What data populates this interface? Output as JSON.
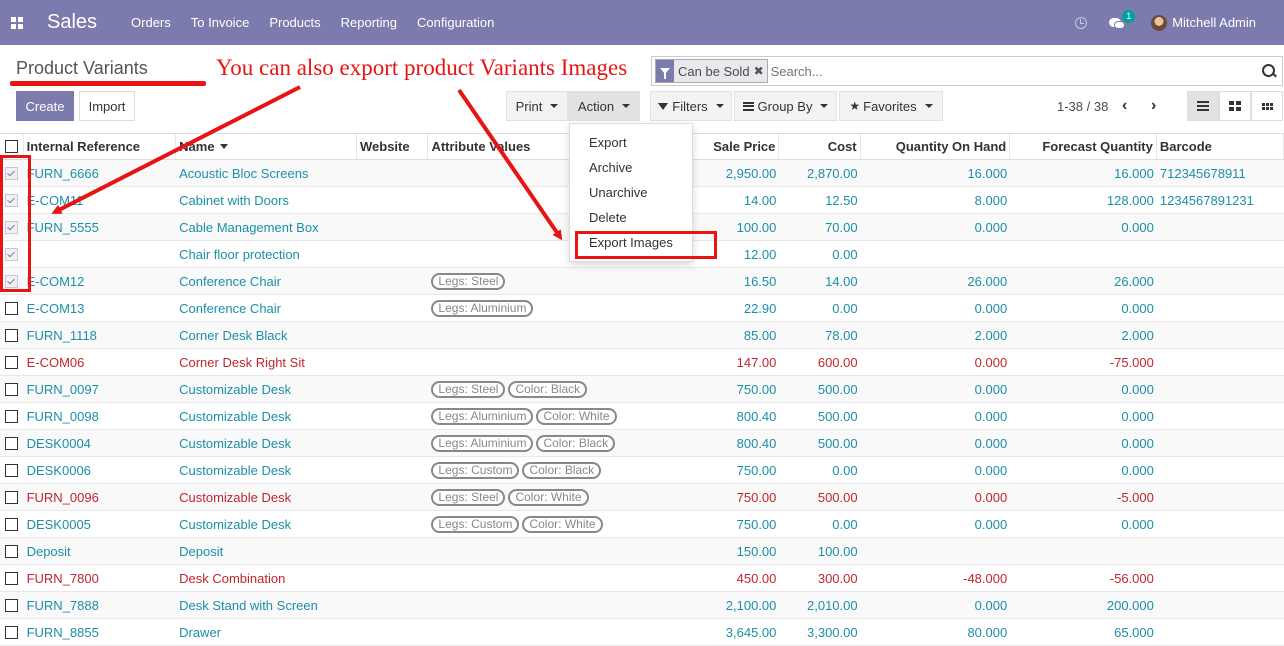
{
  "navbar": {
    "brand": "Sales",
    "menu": [
      "Orders",
      "To Invoice",
      "Products",
      "Reporting",
      "Configuration"
    ],
    "chat_badge": "1",
    "user": "Mitchell Admin"
  },
  "breadcrumb": "Product Variants",
  "annotation": "You can also export product Variants Images",
  "search": {
    "facet": "Can be Sold",
    "placeholder": "Search..."
  },
  "buttons": {
    "create": "Create",
    "import": "Import",
    "print": "Print",
    "action": "Action",
    "filters": "Filters",
    "group_by": "Group By",
    "favorites": "Favorites"
  },
  "pager": "1-38 / 38",
  "action_menu": [
    "Export",
    "Archive",
    "Unarchive",
    "Delete",
    "Export Images"
  ],
  "columns": [
    "Internal Reference",
    "Name",
    "Website",
    "Attribute Values",
    "Sale Price",
    "Cost",
    "Quantity On Hand",
    "Forecast Quantity",
    "Barcode"
  ],
  "rows": [
    {
      "checked": true,
      "ref": "FURN_6666",
      "name": "Acoustic Bloc Screens",
      "attrs": [],
      "sale": "2,950.00",
      "cost": "2,870.00",
      "qoh": "16.000",
      "fq": "16.000",
      "barcode": "712345678911",
      "red": false
    },
    {
      "checked": true,
      "ref": "E-COM11",
      "name": "Cabinet with Doors",
      "attrs": [],
      "sale": "14.00",
      "cost": "12.50",
      "qoh": "8.000",
      "fq": "128.000",
      "barcode": "1234567891231",
      "red": false
    },
    {
      "checked": true,
      "ref": "FURN_5555",
      "name": "Cable Management Box",
      "attrs": [],
      "sale": "100.00",
      "cost": "70.00",
      "qoh": "0.000",
      "fq": "0.000",
      "barcode": "",
      "red": false
    },
    {
      "checked": true,
      "ref": "",
      "name": "Chair floor protection",
      "attrs": [],
      "sale": "12.00",
      "cost": "0.00",
      "qoh": "",
      "fq": "",
      "barcode": "",
      "red": false
    },
    {
      "checked": true,
      "ref": "E-COM12",
      "name": "Conference Chair",
      "attrs": [
        "Legs: Steel"
      ],
      "sale": "16.50",
      "cost": "14.00",
      "qoh": "26.000",
      "fq": "26.000",
      "barcode": "",
      "red": false
    },
    {
      "checked": false,
      "ref": "E-COM13",
      "name": "Conference Chair",
      "attrs": [
        "Legs: Aluminium"
      ],
      "sale": "22.90",
      "cost": "0.00",
      "qoh": "0.000",
      "fq": "0.000",
      "barcode": "",
      "red": false
    },
    {
      "checked": false,
      "ref": "FURN_1118",
      "name": "Corner Desk Black",
      "attrs": [],
      "sale": "85.00",
      "cost": "78.00",
      "qoh": "2.000",
      "fq": "2.000",
      "barcode": "",
      "red": false
    },
    {
      "checked": false,
      "ref": "E-COM06",
      "name": "Corner Desk Right Sit",
      "attrs": [],
      "sale": "147.00",
      "cost": "600.00",
      "qoh": "0.000",
      "fq": "-75.000",
      "barcode": "",
      "red": true
    },
    {
      "checked": false,
      "ref": "FURN_0097",
      "name": "Customizable Desk",
      "attrs": [
        "Legs: Steel",
        "Color: Black"
      ],
      "sale": "750.00",
      "cost": "500.00",
      "qoh": "0.000",
      "fq": "0.000",
      "barcode": "",
      "red": false
    },
    {
      "checked": false,
      "ref": "FURN_0098",
      "name": "Customizable Desk",
      "attrs": [
        "Legs: Aluminium",
        "Color: White"
      ],
      "sale": "800.40",
      "cost": "500.00",
      "qoh": "0.000",
      "fq": "0.000",
      "barcode": "",
      "red": false
    },
    {
      "checked": false,
      "ref": "DESK0004",
      "name": "Customizable Desk",
      "attrs": [
        "Legs: Aluminium",
        "Color: Black"
      ],
      "sale": "800.40",
      "cost": "500.00",
      "qoh": "0.000",
      "fq": "0.000",
      "barcode": "",
      "red": false
    },
    {
      "checked": false,
      "ref": "DESK0006",
      "name": "Customizable Desk",
      "attrs": [
        "Legs: Custom",
        "Color: Black"
      ],
      "sale": "750.00",
      "cost": "0.00",
      "qoh": "0.000",
      "fq": "0.000",
      "barcode": "",
      "red": false
    },
    {
      "checked": false,
      "ref": "FURN_0096",
      "name": "Customizable Desk",
      "attrs": [
        "Legs: Steel",
        "Color: White"
      ],
      "sale": "750.00",
      "cost": "500.00",
      "qoh": "0.000",
      "fq": "-5.000",
      "barcode": "",
      "red": true
    },
    {
      "checked": false,
      "ref": "DESK0005",
      "name": "Customizable Desk",
      "attrs": [
        "Legs: Custom",
        "Color: White"
      ],
      "sale": "750.00",
      "cost": "0.00",
      "qoh": "0.000",
      "fq": "0.000",
      "barcode": "",
      "red": false
    },
    {
      "checked": false,
      "ref": "Deposit",
      "name": "Deposit",
      "attrs": [],
      "sale": "150.00",
      "cost": "100.00",
      "qoh": "",
      "fq": "",
      "barcode": "",
      "red": false
    },
    {
      "checked": false,
      "ref": "FURN_7800",
      "name": "Desk Combination",
      "attrs": [],
      "sale": "450.00",
      "cost": "300.00",
      "qoh": "-48.000",
      "fq": "-56.000",
      "barcode": "",
      "red": true
    },
    {
      "checked": false,
      "ref": "FURN_7888",
      "name": "Desk Stand with Screen",
      "attrs": [],
      "sale": "2,100.00",
      "cost": "2,010.00",
      "qoh": "0.000",
      "fq": "200.000",
      "barcode": "",
      "red": false
    },
    {
      "checked": false,
      "ref": "FURN_8855",
      "name": "Drawer",
      "attrs": [],
      "sale": "3,645.00",
      "cost": "3,300.00",
      "qoh": "80.000",
      "fq": "65.000",
      "barcode": "",
      "red": false
    }
  ],
  "colors": {
    "navbar": "#7c7bad",
    "link": "#1c8fa8",
    "danger": "#c0262d",
    "annotation": "#e81313"
  }
}
